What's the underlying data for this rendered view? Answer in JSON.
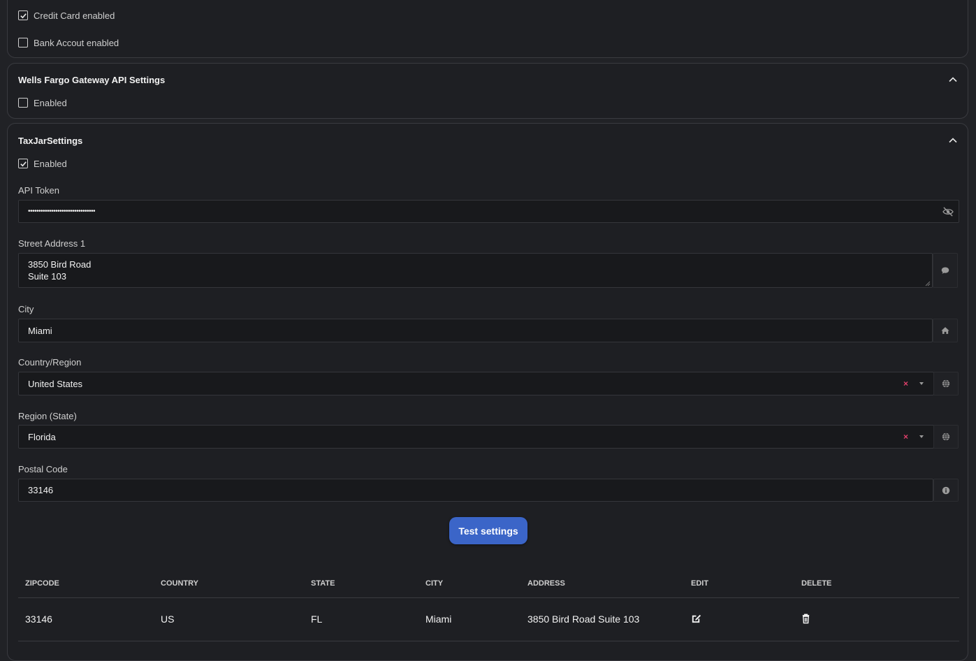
{
  "payment": {
    "credit_card_label": "Credit Card enabled",
    "credit_card_checked": true,
    "bank_account_label": "Bank Accout enabled",
    "bank_account_checked": false
  },
  "wells_fargo": {
    "title": "Wells Fargo Gateway API Settings",
    "enabled_label": "Enabled",
    "enabled_checked": false
  },
  "taxjar": {
    "title": "TaxJarSettings",
    "enabled_label": "Enabled",
    "enabled_checked": true,
    "api_token_label": "API Token",
    "api_token_value": "••••••••••••••••••••••••••••••••",
    "street_label": "Street Address 1",
    "street_line1": "3850 Bird Road",
    "street_line2": "Suite 103",
    "city_label": "City",
    "city_value": "Miami",
    "country_label": "Country/Region",
    "country_value": "United States",
    "region_label": "Region (State)",
    "region_value": "Florida",
    "postal_label": "Postal Code",
    "postal_value": "33146",
    "test_button": "Test settings"
  },
  "table": {
    "headers": [
      "ZIPCODE",
      "COUNTRY",
      "STATE",
      "CITY",
      "ADDRESS",
      "EDIT",
      "DELETE"
    ],
    "rows": [
      [
        "33146",
        "US",
        "FL",
        "Miami",
        "3850 Bird Road Suite 103"
      ]
    ]
  },
  "icons": {
    "chevron": "chevron-up-icon",
    "eye": "eye-slash-icon",
    "comment": "comment-icon",
    "home": "home-icon",
    "globe": "globe-icon",
    "info": "info-icon",
    "edit": "edit-icon",
    "delete": "trash-icon"
  },
  "colors": {
    "accent": "#3b65c8",
    "clear": "#e0406b"
  }
}
